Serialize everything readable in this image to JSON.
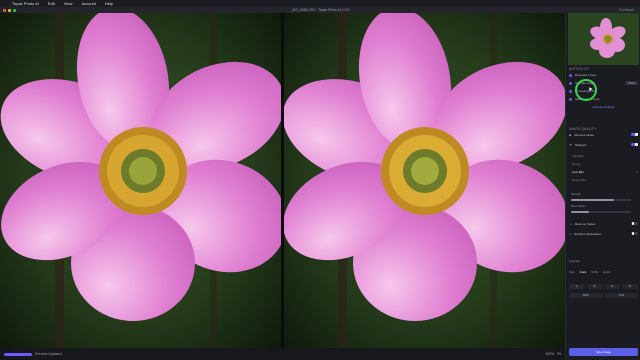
{
  "menubar": {
    "app_name": "Topaz Photo AI",
    "items": [
      "Edit",
      "View",
      "Account",
      "Help"
    ]
  },
  "titlebar": {
    "title": "_MG_0083.CR3 · Topaz Photo AI 1.0.9",
    "right_label": "Feedback"
  },
  "bottombar": {
    "status": "Preview Updated",
    "progress_percent": 100,
    "zoom": "100%",
    "fit_label": "Fit"
  },
  "panel": {
    "autopilot": {
      "title": "AUTOPILOT",
      "rows": [
        {
          "label": "Detected 1 face",
          "chip": ""
        },
        {
          "label": "Upscale Image",
          "chip": "Done"
        },
        {
          "label": "Removing noise",
          "chip": ""
        },
        {
          "label": "Sharpening Focus",
          "chip": ""
        }
      ],
      "link": "Autopilot Settings"
    },
    "image_quality": {
      "title": "IMAGE QUALITY",
      "models": [
        {
          "label": "Remove Noise",
          "on": true
        },
        {
          "label": "Sharpen",
          "on": true
        }
      ],
      "sharpen_options": [
        "Standard",
        "Strong",
        "Lens Blur",
        "Motion Blur"
      ],
      "sharpen_selected": "Lens Blur",
      "sliders": [
        {
          "label": "Strength",
          "value": 0.72
        },
        {
          "label": "Minor Deblur",
          "value": 0.3
        }
      ],
      "extra_models": [
        {
          "label": "Recover Faces",
          "on": false
        },
        {
          "label": "Enhance Resolution",
          "on": false
        }
      ]
    },
    "export": {
      "title": "Upscale",
      "tabs": [
        "Input",
        "Scale",
        "Width",
        "Height"
      ],
      "active_tab": "Scale",
      "fields": [
        "1x",
        "2x",
        "4x",
        "6x"
      ],
      "sizes": [
        "5616",
        "3744"
      ]
    },
    "cta_label": "Save Image"
  },
  "colors": {
    "accent": "#5c5ee8",
    "cursor_ring": "#3fd24a",
    "panel_bg": "#1a1c21"
  },
  "icons": [
    "apple-icon",
    "flower-thumbnail",
    "toggle-icon",
    "cursor-icon"
  ]
}
